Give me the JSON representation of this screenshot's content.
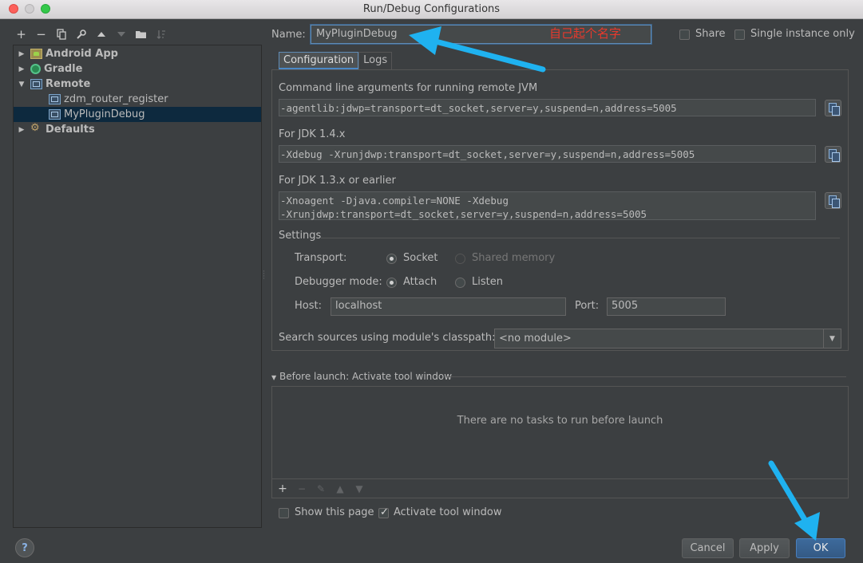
{
  "window": {
    "title": "Run/Debug Configurations"
  },
  "toolbar": {
    "add": "+",
    "remove": "−",
    "copy": "⎘",
    "edit": "🔧",
    "up": "▲",
    "down": "▼",
    "folder": "▇",
    "sort": "⇣"
  },
  "tree": {
    "items": [
      {
        "label": "Android App",
        "icon": "android-icon",
        "arrow": "▶"
      },
      {
        "label": "Gradle",
        "icon": "gradle-icon",
        "arrow": "▶"
      },
      {
        "label": "Remote",
        "icon": "remote-icon",
        "arrow": "▼"
      },
      {
        "label": "zdm_router_register",
        "icon": "remote-config-icon"
      },
      {
        "label": "MyPluginDebug",
        "icon": "remote-config-icon"
      },
      {
        "label": "Defaults",
        "icon": "defaults-icon",
        "arrow": "▶"
      }
    ]
  },
  "name": {
    "label": "Name:",
    "value": "MyPluginDebug",
    "annotation": "自己起个名字"
  },
  "share": {
    "label": "Share",
    "checked": false
  },
  "single_instance": {
    "label": "Single instance only",
    "checked": false
  },
  "tabs": [
    {
      "label": "Configuration"
    },
    {
      "label": "Logs"
    }
  ],
  "config": {
    "cmd_label": "Command line arguments for running remote JVM",
    "cmd_value": "-agentlib:jdwp=transport=dt_socket,server=y,suspend=n,address=5005",
    "jdk14_label": "For JDK 1.4.x",
    "jdk14_value": "-Xdebug -Xrunjdwp:transport=dt_socket,server=y,suspend=n,address=5005",
    "jdk13_label": "For JDK 1.3.x or earlier",
    "jdk13_value": "-Xnoagent -Djava.compiler=NONE -Xdebug\n-Xrunjdwp:transport=dt_socket,server=y,suspend=n,address=5005"
  },
  "settings": {
    "title": "Settings",
    "transport_label": "Transport:",
    "transport_socket": "Socket",
    "transport_shared": "Shared memory",
    "debugger_label": "Debugger mode:",
    "mode_attach": "Attach",
    "mode_listen": "Listen",
    "host_label": "Host:",
    "host_value": "localhost",
    "port_label": "Port:",
    "port_value": "5005",
    "classpath_label": "Search sources using module's classpath:",
    "classpath_value": "<no module>"
  },
  "before_launch": {
    "title": "Before launch: Activate tool window",
    "empty_text": "There are no tasks to run before launch",
    "toolbar": {
      "add": "+",
      "remove": "−",
      "edit": "✎",
      "up": "▲",
      "down": "▼"
    }
  },
  "show_page": {
    "label": "Show this page",
    "checked": false
  },
  "activate_tool": {
    "label": "Activate tool window",
    "checked": true
  },
  "buttons": {
    "help": "?",
    "cancel": "Cancel",
    "apply": "Apply",
    "ok": "OK"
  },
  "colors": {
    "annotation_arrow": "#1fb2f0",
    "annotation_text": "#e8392c"
  }
}
